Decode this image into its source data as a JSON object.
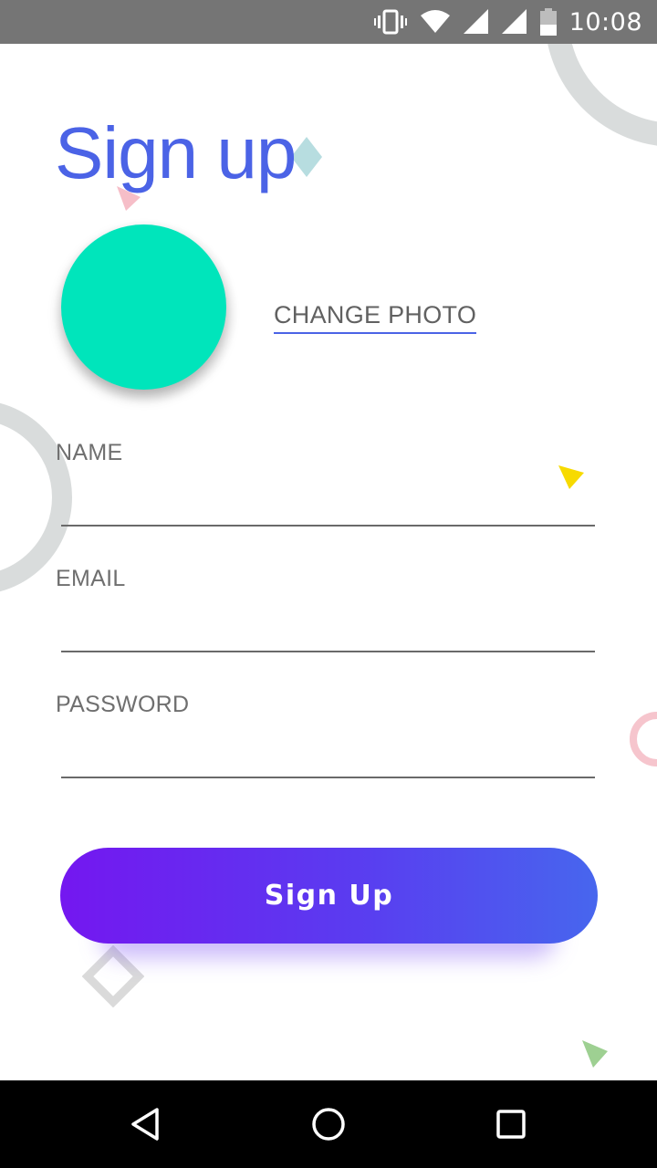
{
  "status_bar": {
    "time": "10:08",
    "icons": [
      "vibrate-icon",
      "wifi-icon",
      "signal-icon",
      "signal-icon",
      "battery-icon"
    ]
  },
  "title": "Sign up",
  "avatar": {
    "color": "#00e5bb"
  },
  "change_photo_label": "CHANGE PHOTO",
  "form": {
    "name": {
      "label": "NAME",
      "value": "",
      "placeholder": ""
    },
    "email": {
      "label": "EMAIL",
      "value": "",
      "placeholder": ""
    },
    "password": {
      "label": "PASSWORD",
      "value": "",
      "placeholder": ""
    }
  },
  "signup_button_label": "Sign Up",
  "colors": {
    "accent": "#4b63e6",
    "gradient_start": "#7417f0",
    "gradient_end": "#4766ee"
  },
  "nav_bar": {
    "buttons": [
      "back-icon",
      "home-icon",
      "recents-icon"
    ]
  }
}
